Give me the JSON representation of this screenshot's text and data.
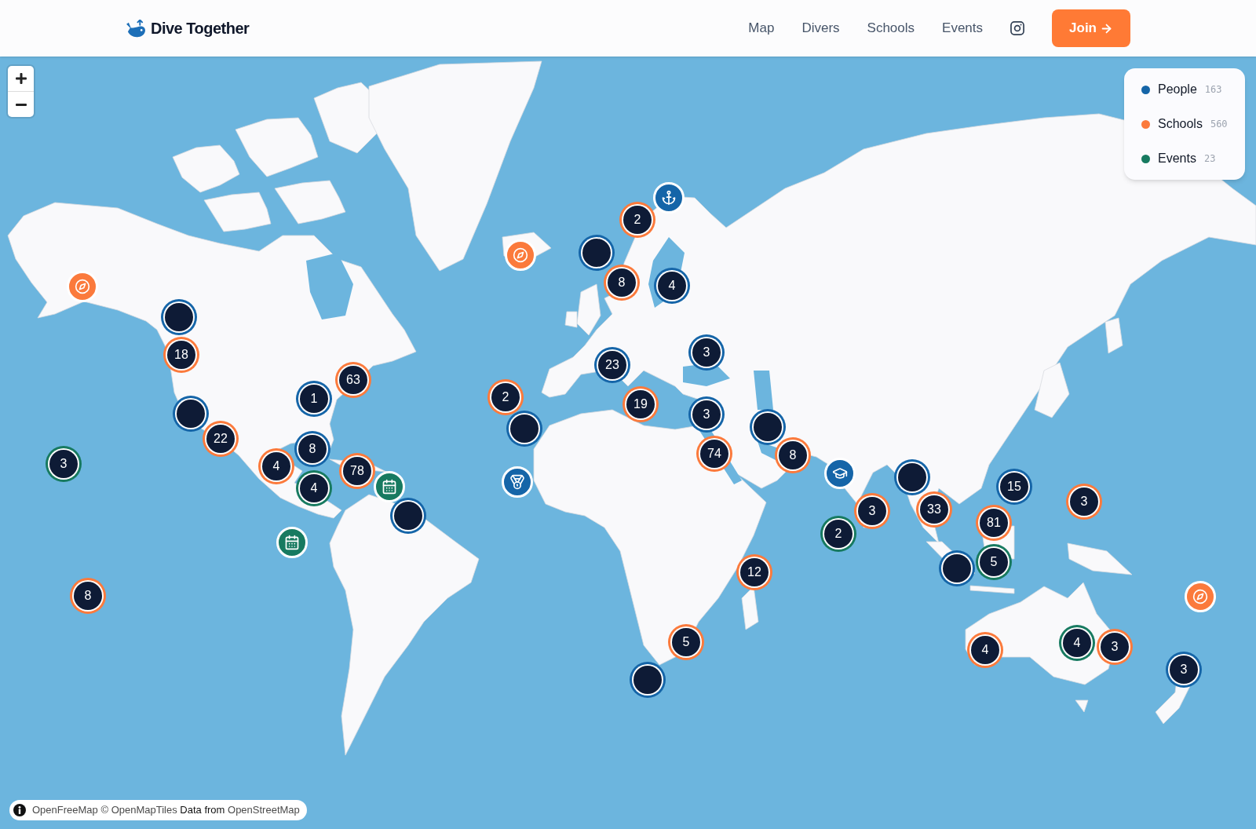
{
  "header": {
    "brand": "Dive Together",
    "nav": [
      {
        "label": "Map"
      },
      {
        "label": "Divers"
      },
      {
        "label": "Schools"
      },
      {
        "label": "Events"
      }
    ],
    "join_button": {
      "label": "Join"
    }
  },
  "map": {
    "legend": [
      {
        "label": "People",
        "count": "163",
        "color": "#1565a8"
      },
      {
        "label": "Schools",
        "count": "560",
        "color": "#fb7a3c"
      },
      {
        "label": "Events",
        "count": "23",
        "color": "#177a60"
      }
    ],
    "markers": [
      {
        "kind": "pin",
        "color": "#fb7a3c"
      },
      {
        "kind": "cluster",
        "color": "#1565a8"
      },
      {
        "kind": "cluster",
        "color": "#fb7a3c",
        "count": "18"
      },
      {
        "kind": "cluster",
        "color": "#1565a8",
        "count": "1"
      },
      {
        "kind": "cluster",
        "color": "#fb7a3c",
        "count": "63"
      },
      {
        "kind": "cluster",
        "color": "#1565a8"
      },
      {
        "kind": "cluster",
        "color": "#fb7a3c",
        "count": "22"
      },
      {
        "kind": "cluster",
        "color": "#177a60",
        "count": "3"
      },
      {
        "kind": "cluster",
        "color": "#fb7a3c",
        "count": "8"
      },
      {
        "kind": "cluster",
        "color": "#1565a8",
        "count": "8"
      },
      {
        "kind": "cluster",
        "color": "#fb7a3c",
        "count": "4"
      },
      {
        "kind": "cluster",
        "color": "#177a60",
        "count": "4"
      },
      {
        "kind": "cluster",
        "color": "#fb7a3c",
        "count": "78"
      },
      {
        "kind": "cluster",
        "color": "#1565a8"
      },
      {
        "kind": "pin",
        "color": "#177a60"
      },
      {
        "kind": "pin",
        "color": "#177a60"
      },
      {
        "kind": "pin",
        "color": "#fb7a3c"
      },
      {
        "kind": "pin",
        "color": "#1565a8"
      },
      {
        "kind": "cluster",
        "color": "#fb7a3c",
        "count": "2"
      },
      {
        "kind": "cluster",
        "color": "#1565a8"
      },
      {
        "kind": "cluster",
        "color": "#fb7a3c",
        "count": "8"
      },
      {
        "kind": "cluster",
        "color": "#1565a8",
        "count": "4"
      },
      {
        "kind": "cluster",
        "color": "#1565a8",
        "count": "23"
      },
      {
        "kind": "cluster",
        "color": "#1565a8",
        "count": "3"
      },
      {
        "kind": "cluster",
        "color": "#1565a8"
      },
      {
        "kind": "cluster",
        "color": "#fb7a3c",
        "count": "2"
      },
      {
        "kind": "cluster",
        "color": "#fb7a3c",
        "count": "19"
      },
      {
        "kind": "cluster",
        "color": "#1565a8",
        "count": "3"
      },
      {
        "kind": "cluster",
        "color": "#fb7a3c",
        "count": "74"
      },
      {
        "kind": "pin",
        "color": "#1565a8"
      },
      {
        "kind": "cluster",
        "color": "#1565a8"
      },
      {
        "kind": "cluster",
        "color": "#fb7a3c",
        "count": "8"
      },
      {
        "kind": "pin",
        "color": "#1565a8"
      },
      {
        "kind": "cluster",
        "color": "#fb7a3c",
        "count": "3"
      },
      {
        "kind": "cluster",
        "color": "#177a60",
        "count": "2"
      },
      {
        "kind": "cluster",
        "color": "#1565a8"
      },
      {
        "kind": "cluster",
        "color": "#fb7a3c",
        "count": "33"
      },
      {
        "kind": "cluster",
        "color": "#1565a8",
        "count": "15"
      },
      {
        "kind": "cluster",
        "color": "#fb7a3c",
        "count": "81"
      },
      {
        "kind": "cluster",
        "color": "#fb7a3c",
        "count": "3"
      },
      {
        "kind": "cluster",
        "color": "#1565a8"
      },
      {
        "kind": "cluster",
        "color": "#177a60",
        "count": "5"
      },
      {
        "kind": "cluster",
        "color": "#fb7a3c",
        "count": "12"
      },
      {
        "kind": "cluster",
        "color": "#1565a8"
      },
      {
        "kind": "cluster",
        "color": "#fb7a3c",
        "count": "5"
      },
      {
        "kind": "pin",
        "color": "#fb7a3c"
      },
      {
        "kind": "cluster",
        "color": "#fb7a3c",
        "count": "4"
      },
      {
        "kind": "cluster",
        "color": "#177a60",
        "count": "4"
      },
      {
        "kind": "cluster",
        "color": "#fb7a3c",
        "count": "3"
      },
      {
        "kind": "cluster",
        "color": "#1565a8",
        "count": "3"
      }
    ],
    "attribution": [
      {
        "kind": "link",
        "text": "OpenFreeMap"
      },
      {
        "kind": "link",
        "text": "© OpenMapTiles"
      },
      {
        "kind": "text",
        "text": "Data from"
      },
      {
        "kind": "link",
        "text": "OpenStreetMap"
      }
    ]
  }
}
